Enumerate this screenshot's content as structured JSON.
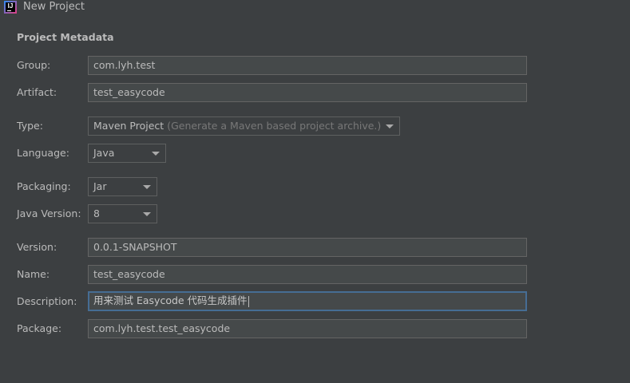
{
  "window": {
    "title": "New Project",
    "icon": "intellij-idea-icon",
    "icon_text": "IJ"
  },
  "section": {
    "title": "Project Metadata"
  },
  "fields": {
    "group": {
      "label": "Group:",
      "value": "com.lyh.test"
    },
    "artifact": {
      "label": "Artifact:",
      "value": "test_easycode"
    },
    "type": {
      "label": "Type:",
      "value": "Maven Project",
      "hint": "(Generate a Maven based project archive.)"
    },
    "language": {
      "label": "Language:",
      "value": "Java"
    },
    "packaging": {
      "label": "Packaging:",
      "value": "Jar"
    },
    "java_version": {
      "label": "Java Version:",
      "value": "8"
    },
    "version": {
      "label": "Version:",
      "value": "0.0.1-SNAPSHOT"
    },
    "name": {
      "label": "Name:",
      "value": "test_easycode"
    },
    "description": {
      "label": "Description:",
      "value": "用来测试 Easycode 代码生成插件"
    },
    "package": {
      "label": "Package:",
      "value": "com.lyh.test.test_easycode"
    }
  },
  "colors": {
    "background": "#3c3f41",
    "field_background": "#45494a",
    "focus_border": "#466d94",
    "text": "#bbbbbb",
    "hint_text": "#787878"
  }
}
